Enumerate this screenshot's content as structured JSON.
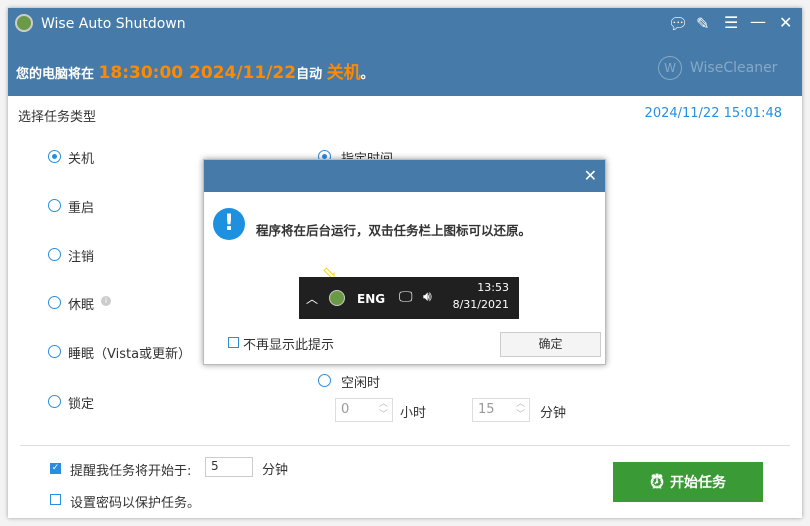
{
  "window": {
    "title": "Wise Auto Shutdown",
    "watermark": "WiseCleaner"
  },
  "banner": {
    "prefix": "您的电脑将在",
    "time": "18:30:00 2024/11/22",
    "middle": "自动",
    "action": "关机",
    "suffix": "。"
  },
  "section": {
    "title": "选择任务类型",
    "current_time": "2024/11/22 15:01:48"
  },
  "tasks": [
    {
      "label": "关机",
      "selected": true
    },
    {
      "label": "重启",
      "selected": false
    },
    {
      "label": "注销",
      "selected": false
    },
    {
      "label": "休眠",
      "selected": false
    },
    {
      "label": "睡眠（Vista或更新）",
      "selected": false
    },
    {
      "label": "锁定",
      "selected": false
    }
  ],
  "timing": {
    "specified": "指定时间",
    "idle": "空闲时",
    "hours_value": "0",
    "hours_unit": "小时",
    "minutes_value": "15",
    "minutes_unit": "分钟"
  },
  "bottom": {
    "remind_label": "提醒我任务将开始于:",
    "remind_value": "5",
    "remind_unit": "分钟",
    "password_label": "设置密码以保护任务。",
    "start_button": "开始任务"
  },
  "dialog": {
    "message": "程序将在后台运行，双击任务栏上图标可以还原。",
    "taskbar_lang": "ENG",
    "taskbar_time": "13:53",
    "taskbar_date": "8/31/2021",
    "dont_show": "不再显示此提示",
    "ok": "确定"
  },
  "colors": {
    "header": "#467ba9",
    "accent": "#ff8a00",
    "blue": "#2a8ee0",
    "green": "#3a9a35"
  }
}
